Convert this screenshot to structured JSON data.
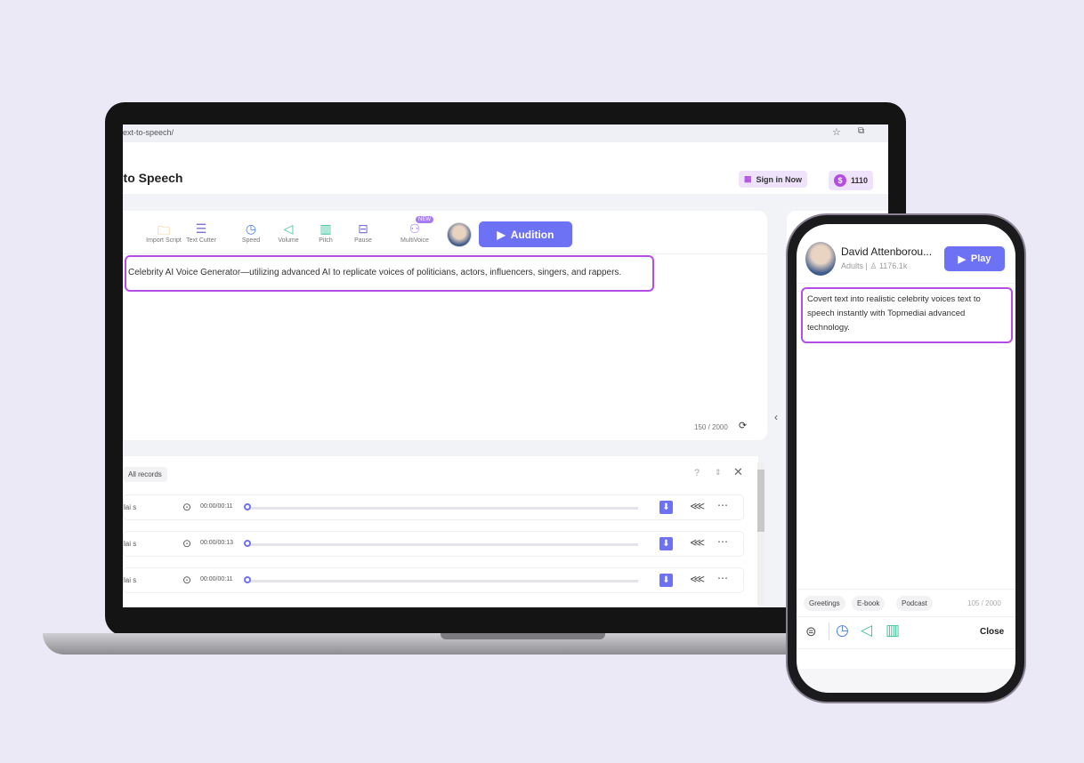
{
  "browser": {
    "url": "ext-to-speech/"
  },
  "header": {
    "title": "t to Speech",
    "sign_in": "Sign in Now",
    "credits": "1110"
  },
  "toolbar": {
    "items": [
      {
        "label": "Import Script",
        "icon": "folder-icon"
      },
      {
        "label": "Text Cutter",
        "icon": "cutter-icon"
      },
      {
        "label": "Speed",
        "icon": "speed-icon"
      },
      {
        "label": "Volume",
        "icon": "volume-icon"
      },
      {
        "label": "Pitch",
        "icon": "pitch-icon"
      },
      {
        "label": "Pause",
        "icon": "pause-icon"
      },
      {
        "label": "MultiVoice",
        "icon": "multivoice-icon"
      }
    ],
    "new_badge": "NEW",
    "audition": "Audition"
  },
  "editor": {
    "text": "Celebrity AI Voice Generator—utilizing advanced AI to replicate voices of politicians, actors, influencers, singers, and rappers.",
    "count": "150",
    "max": "2000"
  },
  "records": {
    "filter": "All records",
    "rows": [
      {
        "name": "lai s",
        "time": "00:00/00:11"
      },
      {
        "name": "lai s",
        "time": "00:00/00:13"
      },
      {
        "name": "lai s",
        "time": "00:00/00:11"
      }
    ]
  },
  "phone": {
    "voice_name": "David Attenborou...",
    "category": "Adults",
    "uses": "1176.1k",
    "play": "Play",
    "text": "Covert text into realistic celebrity voices text to speech instantly with Topmediai advanced technology.",
    "tags": [
      "Greetings",
      "E-book",
      "Podcast"
    ],
    "count": "105 / 2000",
    "close": "Close"
  },
  "colors": {
    "accent": "#6d71f4",
    "highlight": "#b44de6",
    "background": "#ece9f7"
  }
}
